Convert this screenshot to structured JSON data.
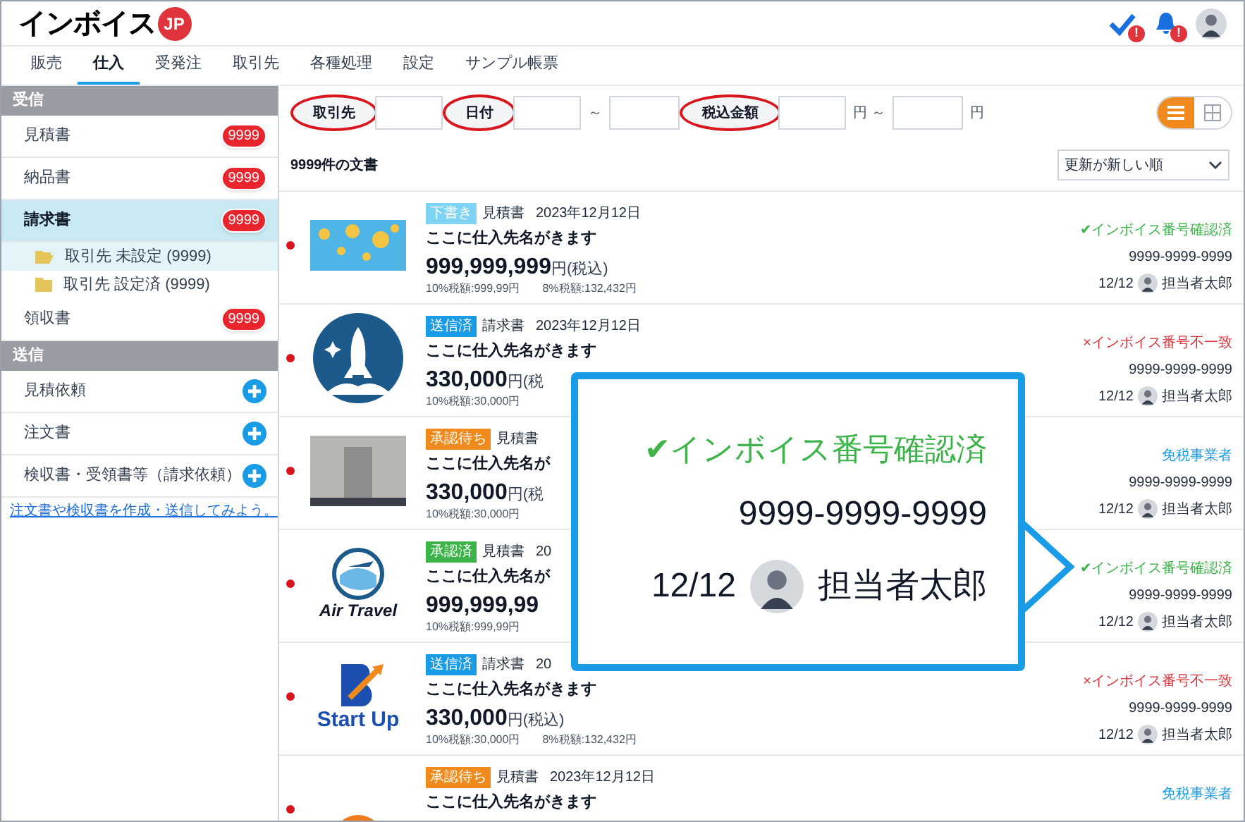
{
  "app": {
    "logo_text": "インボイス",
    "logo_badge": "JP"
  },
  "header_icons": [
    {
      "kind": "check",
      "alert": "!"
    },
    {
      "kind": "bell",
      "alert": "!"
    },
    {
      "kind": "avatar"
    }
  ],
  "tabs": [
    {
      "label": "販売",
      "selected": false
    },
    {
      "label": "仕入",
      "selected": true
    },
    {
      "label": "受発注",
      "selected": false
    },
    {
      "label": "取引先",
      "selected": false
    },
    {
      "label": "各種処理",
      "selected": false
    },
    {
      "label": "設定",
      "selected": false
    },
    {
      "label": "サンプル帳票",
      "selected": false
    }
  ],
  "sidebar": {
    "sections": [
      {
        "title": "受信",
        "items": [
          {
            "kind": "count",
            "label": "見積書",
            "badge": "9999",
            "selected": false
          },
          {
            "kind": "count",
            "label": "納品書",
            "badge": "9999",
            "selected": false
          },
          {
            "kind": "count",
            "label": "請求書",
            "badge": "9999",
            "selected": true,
            "children": [
              {
                "label": "取引先 未設定 (9999)",
                "selected": true
              },
              {
                "label": "取引先 設定済 (9999)",
                "selected": false
              }
            ]
          },
          {
            "kind": "count",
            "label": "領収書",
            "badge": "9999",
            "selected": false
          }
        ]
      },
      {
        "title": "送信",
        "items": [
          {
            "kind": "add",
            "label": "見積依頼"
          },
          {
            "kind": "add",
            "label": "注文書"
          },
          {
            "kind": "add",
            "label": "検収書・受領書等（請求依頼）"
          }
        ]
      }
    ],
    "link": "注文書や検収書を作成・送信してみよう。"
  },
  "filters": [
    {
      "kind": "field",
      "label": "取引先",
      "circled": true
    },
    {
      "kind": "field",
      "label": "日付",
      "circled": true
    },
    {
      "kind": "text",
      "text": "～"
    },
    {
      "kind": "input"
    },
    {
      "kind": "field",
      "label": "税込金額",
      "circled": true
    },
    {
      "kind": "text",
      "text": "円 ～"
    },
    {
      "kind": "input"
    },
    {
      "kind": "text",
      "text": "円"
    }
  ],
  "view_toggle": [
    {
      "kind": "list",
      "selected": true
    },
    {
      "kind": "grid",
      "selected": false
    }
  ],
  "count_text": "9999件の文書",
  "sort": {
    "value": "更新が新しい順"
  },
  "documents": [
    {
      "unread": true,
      "thumb": {
        "kind": "balloons"
      },
      "status": {
        "label": "下書き",
        "color": "#7fd3f5"
      },
      "doc_type": "見積書",
      "date": "2023年12月12日",
      "vendor": "ここに仕入先名がきます",
      "amount": "999,999,999",
      "amount_suffix": "円(税込)",
      "tax10": "10%税額:999,99円",
      "tax8": "8%税額:132,432円",
      "invoice": {
        "kind": "verified",
        "text": "✔インボイス番号確認済"
      },
      "number": "9999-9999-9999",
      "updated": "12/12",
      "person": "担当者太郎"
    },
    {
      "unread": true,
      "thumb": {
        "kind": "rocket"
      },
      "status": {
        "label": "送信済",
        "color": "#1a9be6"
      },
      "doc_type": "請求書",
      "date": "2023年12月12日",
      "vendor": "ここに仕入先名がきます",
      "amount": "330,000",
      "amount_suffix": "円(税",
      "tax10": "10%税額:30,000円",
      "invoice": {
        "kind": "mismatch",
        "text": "×インボイス番号不一致"
      },
      "number": "9999-9999-9999",
      "updated": "12/12",
      "person": "担当者太郎"
    },
    {
      "unread": true,
      "thumb": {
        "kind": "elevator"
      },
      "status": {
        "label": "承認待ち",
        "color": "#f08a1c"
      },
      "doc_type": "見積書",
      "vendor": "ここに仕入先名が",
      "amount": "330,000",
      "amount_suffix": "円(税",
      "tax10": "10%税額:30,000円",
      "invoice": {
        "kind": "exempt",
        "text": "免税事業者"
      },
      "number": "9999-9999-9999",
      "updated": "12/12",
      "person": "担当者太郎"
    },
    {
      "unread": true,
      "thumb": {
        "kind": "airtravel",
        "text": "Air Travel"
      },
      "status": {
        "label": "承認済",
        "color": "#3cb44a"
      },
      "doc_type": "見積書",
      "date": "20",
      "vendor": "ここに仕入先名が",
      "amount": "999,999,99",
      "tax10": "10%税額:999,99円",
      "invoice": {
        "kind": "verified",
        "text": "✔インボイス番号確認済"
      },
      "number": "9999-9999-9999",
      "updated": "12/12",
      "person": "担当者太郎"
    },
    {
      "unread": true,
      "thumb": {
        "kind": "startup",
        "text": "Start Up"
      },
      "status": {
        "label": "送信済",
        "color": "#1a9be6"
      },
      "doc_type": "請求書",
      "date": "20",
      "vendor": "ここに仕入先名がきます",
      "amount": "330,000",
      "amount_suffix": "円(税込)",
      "tax10": "10%税額:30,000円",
      "tax8": "8%税額:132,432円",
      "invoice": {
        "kind": "mismatch",
        "text": "×インボイス番号不一致"
      },
      "number": "9999-9999-9999",
      "updated": "12/12",
      "person": "担当者太郎"
    },
    {
      "unread": true,
      "thumb": {
        "kind": "m"
      },
      "status": {
        "label": "承認待ち",
        "color": "#f08a1c"
      },
      "doc_type": "見積書",
      "date": "2023年12月12日",
      "vendor": "ここに仕入先名がきます",
      "invoice": {
        "kind": "exempt",
        "text": "免税事業者"
      }
    }
  ],
  "callout": {
    "invoice": {
      "kind": "verified",
      "text": "✔インボイス番号確認済"
    },
    "number": "9999-9999-9999",
    "updated": "12/12",
    "person": "担当者太郎"
  }
}
